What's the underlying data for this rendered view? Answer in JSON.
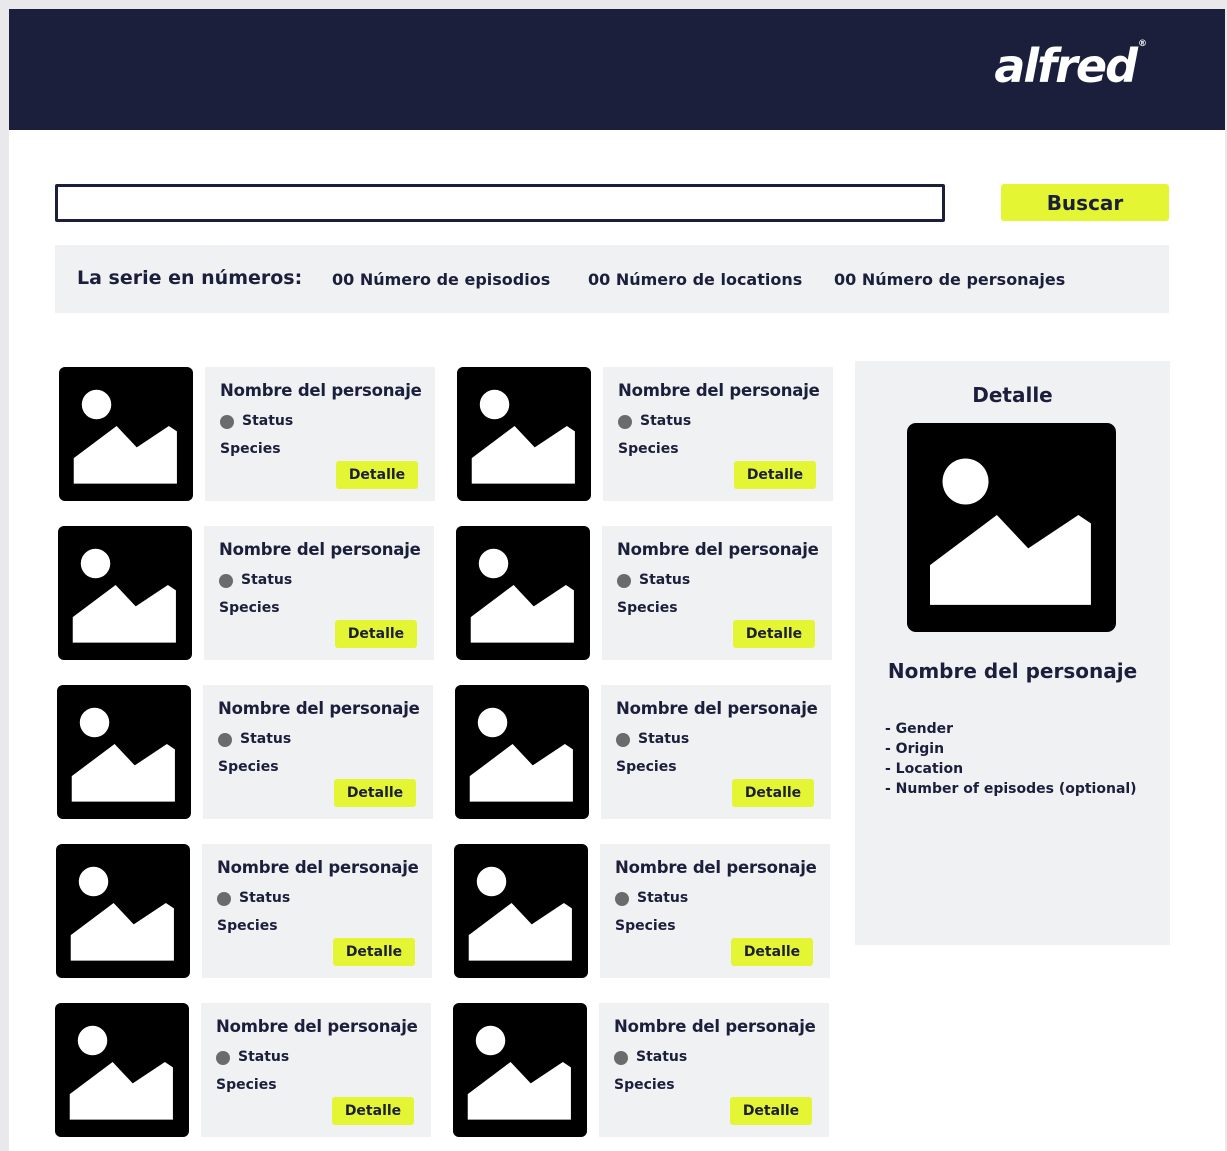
{
  "header": {
    "logo_text": "alfred",
    "logo_mark": "®"
  },
  "search": {
    "placeholder": "",
    "value": "",
    "button_label": "Buscar"
  },
  "stats": {
    "title": "La serie en números:",
    "episodes": "00 Número de episodios",
    "locations": "00 Número de locations",
    "characters": "00 Número de personajes"
  },
  "cards": [
    {
      "name": "Nombre del personaje",
      "status": "Status",
      "species": "Species",
      "button": "Detalle",
      "icon": "image-placeholder-icon"
    },
    {
      "name": "Nombre del personaje",
      "status": "Status",
      "species": "Species",
      "button": "Detalle",
      "icon": "image-placeholder-icon"
    },
    {
      "name": "Nombre del personaje",
      "status": "Status",
      "species": "Species",
      "button": "Detalle",
      "icon": "image-placeholder-icon"
    },
    {
      "name": "Nombre del personaje",
      "status": "Status",
      "species": "Species",
      "button": "Detalle",
      "icon": "image-placeholder-icon"
    },
    {
      "name": "Nombre del personaje",
      "status": "Status",
      "species": "Species",
      "button": "Detalle",
      "icon": "image-placeholder-icon"
    },
    {
      "name": "Nombre del personaje",
      "status": "Status",
      "species": "Species",
      "button": "Detalle",
      "icon": "image-placeholder-icon"
    },
    {
      "name": "Nombre del personaje",
      "status": "Status",
      "species": "Species",
      "button": "Detalle",
      "icon": "image-placeholder-icon"
    },
    {
      "name": "Nombre del personaje",
      "status": "Status",
      "species": "Species",
      "button": "Detalle",
      "icon": "image-placeholder-icon"
    },
    {
      "name": "Nombre del personaje",
      "status": "Status",
      "species": "Species",
      "button": "Detalle",
      "icon": "image-placeholder-icon"
    },
    {
      "name": "Nombre del personaje",
      "status": "Status",
      "species": "Species",
      "button": "Detalle",
      "icon": "image-placeholder-icon"
    }
  ],
  "detail": {
    "title": "Detalle",
    "name": "Nombre del personaje",
    "fields": [
      "- Gender",
      "- Origin",
      "- Location",
      "- Number of episodes (optional)"
    ]
  },
  "colors": {
    "header_bg": "#1b1f3b",
    "accent": "#e4f534",
    "panel_bg": "#f0f1f3",
    "status_dot": "#6b6b6b"
  }
}
